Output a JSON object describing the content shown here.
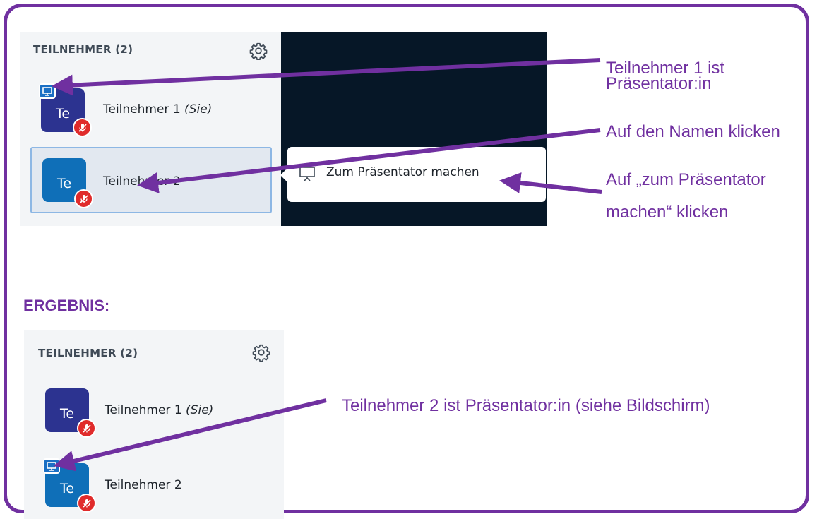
{
  "step1": {
    "panel_title": "TEILNEHMER (2)",
    "participants": [
      {
        "initials": "Te",
        "name": "Teilnehmer 1",
        "suffix": "(Sie)",
        "presenter": true
      },
      {
        "initials": "Te",
        "name": "Teilnehmer 2",
        "suffix": "",
        "presenter": false,
        "selected": true
      }
    ],
    "popup_item": "Zum Präsentator machen"
  },
  "annotations": {
    "presenter_line1": "Teilnehmer 1 ist",
    "presenter_line2": "Präsentator:in",
    "click_name": "Auf den Namen klicken",
    "click_make_line1": "Auf „zum Präsentator",
    "click_make_line2": "machen“ klicken",
    "result_note": "Teilnehmer 2 ist Präsentator:in (siehe Bildschirm)"
  },
  "result_heading": "ERGEBNIS:",
  "step2": {
    "panel_title": "TEILNEHMER (2)",
    "participants": [
      {
        "initials": "Te",
        "name": "Teilnehmer 1",
        "suffix": "(Sie)",
        "presenter": false
      },
      {
        "initials": "Te",
        "name": "Teilnehmer 2",
        "suffix": "",
        "presenter": true
      }
    ]
  },
  "colors": {
    "annotation": "#7030a0",
    "avatar_dark": "#2c3390",
    "avatar_blue": "#0f6fb8",
    "muted_badge": "#e02b2b",
    "presenter_badge": "#1a6fc4",
    "stage_background": "#061727"
  },
  "icons": [
    "settings-gear-icon",
    "muted-mic-icon",
    "presenter-icon",
    "presentation-board-icon"
  ]
}
